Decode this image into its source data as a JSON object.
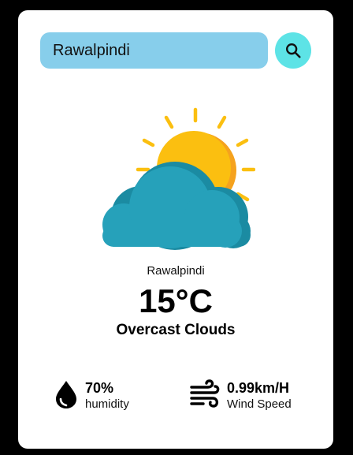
{
  "search": {
    "value": "Rawalpindi",
    "icon": "search-icon"
  },
  "weather": {
    "icon": "partly-cloudy-icon",
    "city": "Rawalpindi",
    "temperature": "15°C",
    "condition": "Overcast Clouds"
  },
  "humidity": {
    "icon": "humidity-drop-icon",
    "value": "70%",
    "label": "humidity"
  },
  "wind": {
    "icon": "wind-icon",
    "value": "0.99km/H",
    "label": "Wind Speed"
  },
  "colors": {
    "background": "#000000",
    "card": "#ffffff",
    "search_input": "#87ceeb",
    "search_button": "#5de3e6",
    "sun": "#fbbf10",
    "cloud": "#26a1ba"
  }
}
